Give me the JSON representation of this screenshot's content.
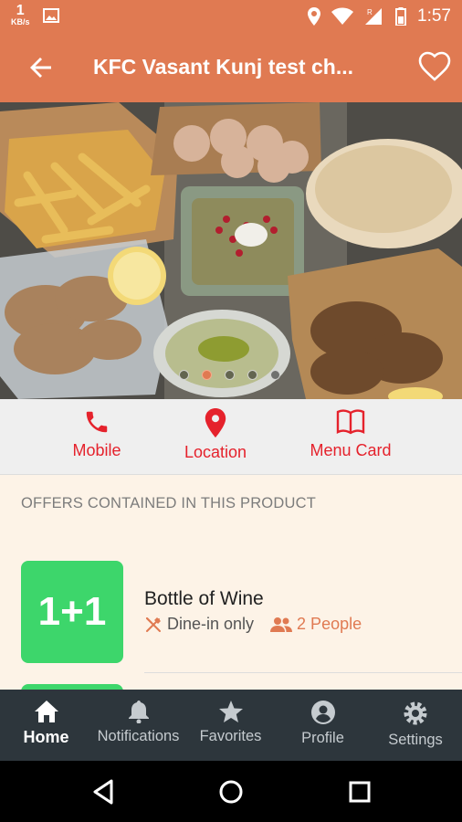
{
  "status_bar": {
    "speed_value": "1",
    "speed_unit": "KB/s",
    "time": "1:57",
    "icons": [
      "image-icon",
      "location-icon",
      "wifi-icon",
      "signal-icon",
      "battery-icon"
    ]
  },
  "app_bar": {
    "title": "KFC Vasant Kunj test ch...",
    "back_icon": "back-arrow-icon",
    "favorite_icon": "heart-outline-icon"
  },
  "gallery": {
    "total_images": 5,
    "active_index": 1
  },
  "actions": [
    {
      "label": "Mobile",
      "icon": "phone-icon"
    },
    {
      "label": "Location",
      "icon": "location-pin-icon"
    },
    {
      "label": "Menu Card",
      "icon": "book-icon"
    }
  ],
  "offers": {
    "heading": "OFFERS CONTAINED IN THIS PRODUCT",
    "items": [
      {
        "badge": "1+1",
        "title": "Bottle of Wine",
        "dine_label": "Dine-in only",
        "people_label": "2 People"
      }
    ]
  },
  "bottom_nav": [
    {
      "label": "Home",
      "icon": "home-icon",
      "active": true
    },
    {
      "label": "Notifications",
      "icon": "bell-icon",
      "active": false
    },
    {
      "label": "Favorites",
      "icon": "star-icon",
      "active": false
    },
    {
      "label": "Profile",
      "icon": "profile-icon",
      "active": false
    },
    {
      "label": "Settings",
      "icon": "gear-icon",
      "active": false
    }
  ],
  "colors": {
    "brand": "#e07a52",
    "action_red": "#e5222c",
    "offer_green": "#3dd66b",
    "content_bg": "#fdf3e7",
    "nav_bg": "#2d363c"
  }
}
